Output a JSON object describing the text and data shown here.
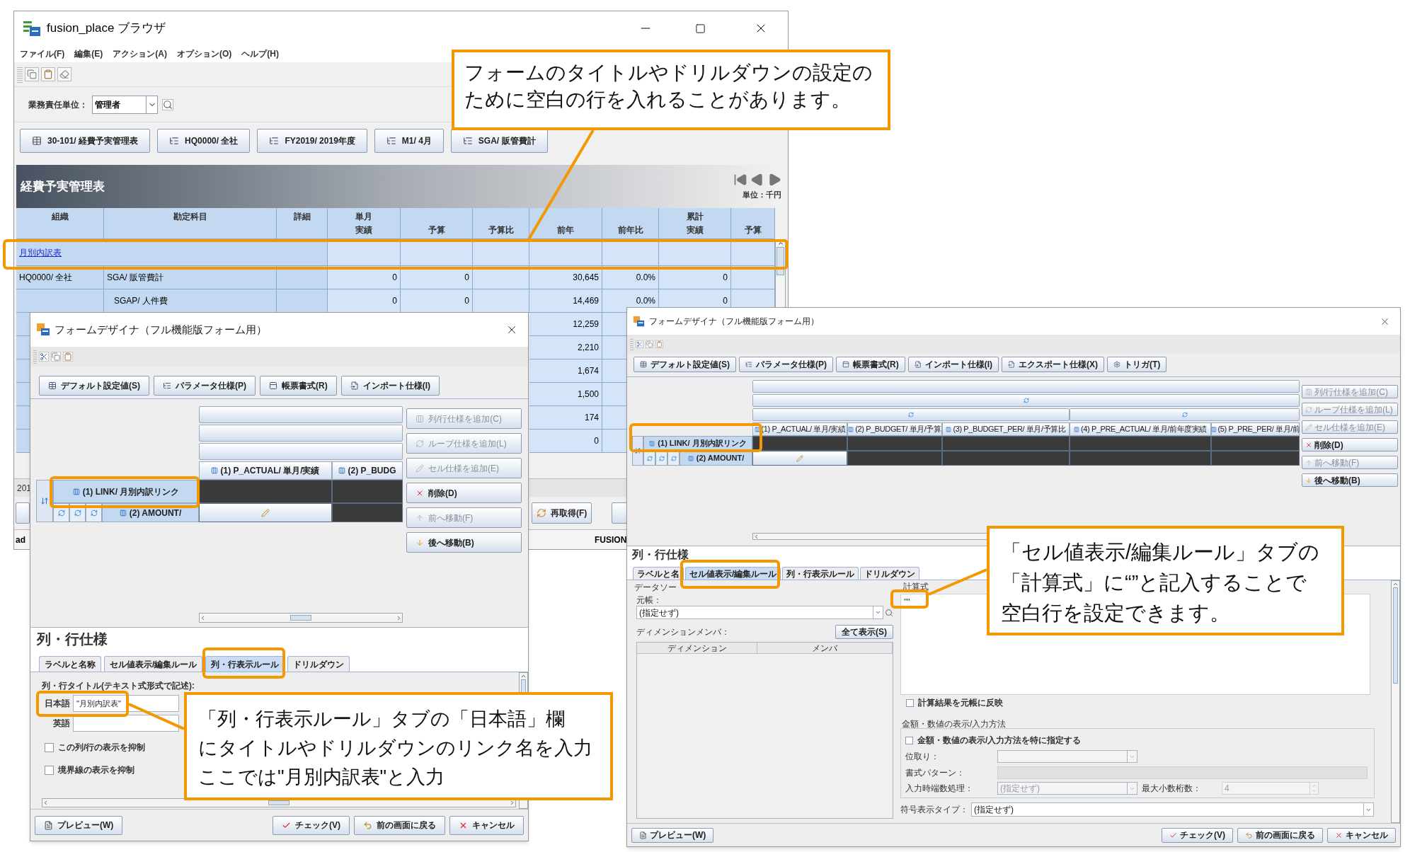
{
  "browser": {
    "title": "fusion_place ブラウザ",
    "menu": [
      "ファイル(F)",
      "編集(E)",
      "アクション(A)",
      "オプション(O)",
      "ヘルプ(H)"
    ],
    "unit_field": {
      "label": "業務責任単位：",
      "value": "管理者"
    },
    "params": [
      {
        "label": "30-101/ 経費予実管理表",
        "kind": "form"
      },
      {
        "label": "HQ0000/ 全社",
        "kind": "tree"
      },
      {
        "label": "FY2019/ 2019年度",
        "kind": "tree"
      },
      {
        "label": "M1/ 4月",
        "kind": "tree"
      },
      {
        "label": "SGA/ 販管費計",
        "kind": "tree"
      }
    ],
    "report_title": "経費予実管理表",
    "unit": "単位：千円",
    "table": {
      "columns": [
        {
          "top": "組織"
        },
        {
          "top": "勘定科目"
        },
        {
          "top": "詳細"
        },
        {
          "top": "単月",
          "bottom": "実績"
        },
        {
          "bottom": "予算"
        },
        {
          "bottom": "予算比"
        },
        {
          "bottom": "前年"
        },
        {
          "bottom": "前年比"
        },
        {
          "top": "累計",
          "bottom": "実績"
        },
        {
          "bottom": "予算"
        }
      ],
      "rows": [
        {
          "kind": "link",
          "label": "月別内訳表"
        },
        {
          "kind": "data",
          "org": "HQ0000/ 全社",
          "account": "SGA/ 販管費計",
          "monthly_actual": "0",
          "budget": "0",
          "prior_year": "30,645",
          "prior_year_ratio": "0.0%",
          "cumulative_actual": "0",
          "children": [
            {
              "kind": "data",
              "account": "SGAP/ 人件費",
              "monthly_actual": "0",
              "budget": "0",
              "prior_year": "14,469",
              "prior_year_ratio": "0.0%",
              "cumulative_actual": "0"
            },
            {
              "kind": "partial",
              "prior_year": "12,259"
            },
            {
              "kind": "partial",
              "prior_year": "2,210"
            },
            {
              "kind": "partial",
              "prior_year": "1,674"
            },
            {
              "kind": "partial",
              "prior_year": "1,500"
            },
            {
              "kind": "partial",
              "prior_year": "174"
            },
            {
              "kind": "partial",
              "prior_year": "0"
            }
          ]
        }
      ]
    },
    "year_row": "201",
    "refresh_button": "再取得(F)",
    "status_left": "ad",
    "status_right": "FUSION"
  },
  "designers": [
    {
      "title": "フォームデザイナ（フル機能版フォーム用）",
      "sections": [
        {
          "label": "デフォルト設定値(S)",
          "kind": "defaults"
        },
        {
          "label": "パラメータ仕様(P)",
          "kind": "parameters"
        },
        {
          "label": "帳票書式(R)",
          "kind": "layout"
        },
        {
          "label": "インポート仕様(I)",
          "kind": "import"
        }
      ],
      "header_bars": [
        [
          {
            "loop": false
          }
        ],
        [
          {
            "loop": false
          }
        ],
        [
          {
            "loop": false
          }
        ]
      ],
      "columns": [
        "(1) P_ACTUAL/ 単月/実績",
        "(2) P_BUDG"
      ],
      "rows": [
        {
          "label": "(1) LINK/ 月別内訳リンク",
          "loop_icons": false,
          "cells": [
            {
              "formula": false
            },
            {
              "formula": false
            }
          ]
        },
        {
          "label": "(2) AMOUNT/",
          "loop_icons": true,
          "cells": [
            {
              "formula": true
            },
            {
              "formula": false
            }
          ]
        }
      ],
      "actions": [
        {
          "label": "列/行仕様を追加(C)",
          "kind": "add_column",
          "disabled": true
        },
        {
          "label": "ループ仕様を追加(L)",
          "kind": "add_loop",
          "disabled": true
        },
        {
          "label": "セル仕様を追加(E)",
          "kind": "add_cell",
          "disabled": true
        },
        {
          "label": "削除(D)",
          "kind": "delete",
          "disabled": false
        },
        {
          "label": "前へ移動(F)",
          "kind": "move_up",
          "disabled": true
        },
        {
          "label": "後へ移動(B)",
          "kind": "move_down",
          "disabled": false
        }
      ],
      "spec_heading": "列・行仕様",
      "spec_tabs": [
        {
          "label": "ラベルと名称",
          "selected": false
        },
        {
          "label": "セル値表示/編集ルール",
          "selected": false
        },
        {
          "label": "列・行表示ルール",
          "selected": true
        },
        {
          "label": "ドリルダウン",
          "selected": false
        }
      ],
      "panel": {
        "kind": "display_rule",
        "caption": "列・行タイトル(テキスト式形式で記述):",
        "fields": [
          {
            "label": "日本語",
            "value": "\"月別内訳表\""
          },
          {
            "label": "英語"
          }
        ],
        "checks": [
          {
            "label": "この列/行の表示を抑制",
            "checked": false
          },
          {
            "label": "境界線の表示を抑制",
            "checked": false
          }
        ]
      },
      "footer": [
        {
          "label": "プレビュー(W)",
          "kind": "preview"
        },
        {
          "label": "チェック(V)",
          "kind": "check"
        },
        {
          "label": "前の画面に戻る",
          "kind": "back"
        },
        {
          "label": "キャンセル",
          "kind": "cancel"
        }
      ]
    },
    {
      "title": "フォームデザイナ（フル機能版フォーム用）",
      "sections": [
        {
          "label": "デフォルト設定値(S)",
          "kind": "defaults"
        },
        {
          "label": "パラメータ仕様(P)",
          "kind": "parameters"
        },
        {
          "label": "帳票書式(R)",
          "kind": "layout"
        },
        {
          "label": "インポート仕様(I)",
          "kind": "import"
        },
        {
          "label": "エクスポート仕様(X)",
          "kind": "export"
        },
        {
          "label": "トリガ(T)",
          "kind": "trigger"
        }
      ],
      "header_bars": [
        [
          {
            "loop": false
          }
        ],
        [
          {
            "loop": true
          }
        ],
        [
          {
            "loop": true
          },
          {
            "loop": true
          }
        ]
      ],
      "columns": [
        "(1) P_ACTUAL/ 単月/実績",
        "(2) P_BUDGET/ 単月/予算",
        "(3) P_BUDGET_PER/ 単月/予算比",
        "(4) P_PRE_ACTUAL/ 単月/前年度実績",
        "(5) P_PRE_PER/ 単月/前"
      ],
      "rows": [
        {
          "label": "(1) LINK/ 月別内訳リンク",
          "loop_icons": false,
          "cells": [
            {
              "formula": false
            },
            {
              "formula": false
            },
            {
              "formula": false
            },
            {
              "formula": false
            },
            {
              "formula": false
            }
          ]
        },
        {
          "label": "(2) AMOUNT/",
          "loop_icons": true,
          "cells": [
            {
              "formula": true
            },
            {
              "formula": false
            },
            {
              "formula": false
            },
            {
              "formula": false
            },
            {
              "formula": false
            }
          ]
        }
      ],
      "actions": [
        {
          "label": "列/行仕様を追加(C)",
          "kind": "add_column",
          "disabled": true
        },
        {
          "label": "ループ仕様を追加(L)",
          "kind": "add_loop",
          "disabled": true
        },
        {
          "label": "セル仕様を追加(E)",
          "kind": "add_cell",
          "disabled": true
        },
        {
          "label": "削除(D)",
          "kind": "delete",
          "disabled": false
        },
        {
          "label": "前へ移動(F)",
          "kind": "move_up",
          "disabled": true
        },
        {
          "label": "後へ移動(B)",
          "kind": "move_down",
          "disabled": false
        }
      ],
      "spec_heading": "列・行仕様",
      "spec_tabs": [
        {
          "label": "ラベルと名",
          "selected": false
        },
        {
          "label": "セル値表示/編集ルール",
          "selected": true
        },
        {
          "label": "列・行表示ルール",
          "selected": false
        },
        {
          "label": "ドリルダウン",
          "selected": false
        }
      ],
      "panel": {
        "kind": "cell_rule",
        "source_group": "データソー",
        "ledger_label": "元帳：",
        "ledger_value": "(指定せず)",
        "dim_label": "ディメンションメンバ：",
        "show_all": "全て表示(S)",
        "dim_columns": [
          "ディメンション",
          "メンバ"
        ],
        "formula_label": "計算式",
        "formula": "\"\"",
        "reflect": {
          "label": "計算結果を元帳に反映",
          "checked": false
        },
        "amount_group": "金額・数値の表示/入力方法",
        "amount_check": {
          "label": "金額・数値の表示/入力方法を特に指定する",
          "checked": false
        },
        "scale_label": "位取り：",
        "pattern_label": "書式パターン：",
        "rounding_label": "入力時端数処理：",
        "rounding_value": "(指定せず)",
        "decimals_label": "最大小数桁数：",
        "decimals_value": "4",
        "sign_label": "符号表示タイプ：",
        "sign_value": "(指定せず)"
      },
      "footer": [
        {
          "label": "プレビュー(W)",
          "kind": "preview"
        },
        {
          "label": "チェック(V)",
          "kind": "check"
        },
        {
          "label": "前の画面に戻る",
          "kind": "back"
        },
        {
          "label": "キャンセル",
          "kind": "cancel"
        }
      ]
    }
  ],
  "callouts": [
    {
      "lines": [
        "フォームのタイトルやドリルダウンの設定の",
        "ために空白の行を入れることがあります。"
      ]
    },
    {
      "lines": [
        "「列・行表示ルール」タブの「日本語」欄",
        "にタイトルやドリルダウンのリンク名を入力",
        "ここでは\"月別内訳表\"と入力"
      ]
    },
    {
      "lines": [
        "「セル値表示/編集ルール」タブの",
        "「計算式」に“”と記入することで",
        "空白行を設定できます。"
      ]
    }
  ]
}
